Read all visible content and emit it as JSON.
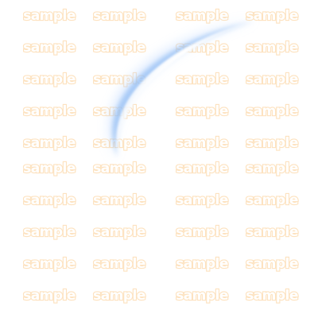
{
  "watermark": {
    "text": "sample",
    "text_color": "#ffffff",
    "outline_color": "#fde2bf",
    "columns": 4,
    "rows": 10
  },
  "effect": {
    "icon": "slash-sweep-icon",
    "colors": {
      "glow": "#cfe3ff",
      "mid": "#8fbcf5",
      "core": "#ffffff"
    }
  }
}
